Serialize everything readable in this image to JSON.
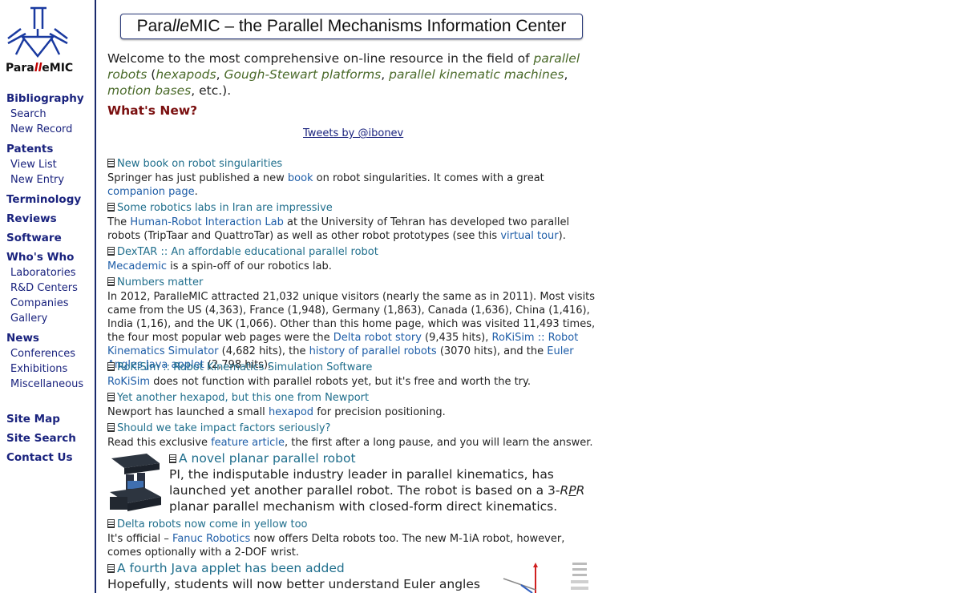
{
  "logo": {
    "part1": "Para",
    "part2": "ll",
    "part3": "eMIC"
  },
  "sidebar": {
    "bibliography": "Bibliography",
    "search": "Search",
    "new_record": "New Record",
    "patents": "Patents",
    "view_list": "View List",
    "new_entry": "New Entry",
    "terminology": "Terminology",
    "reviews": "Reviews",
    "software": "Software",
    "whos_who": "Who's Who",
    "laboratories": "Laboratories",
    "rd_centers": "R&D Centers",
    "companies": "Companies",
    "gallery": "Gallery",
    "news": "News",
    "conferences": "Conferences",
    "exhibitions": "Exhibitions",
    "miscellaneous": "Miscellaneous",
    "site_map": "Site Map",
    "site_search": "Site Search",
    "contact_us": "Contact Us"
  },
  "banner": {
    "pre": "Para",
    "it": "lle",
    "post": "MIC – the Parallel Mechanisms Information Center"
  },
  "welcome": {
    "t1": "Welcome to the most comprehensive on-line resource in the field of ",
    "l1": "parallel robots",
    "t2": " (",
    "l2": "hexapods",
    "t3": ", ",
    "l3": "Gough-Stewart platforms",
    "t4": ", ",
    "l4": "parallel kinematic machines",
    "t5": ", ",
    "l5": "motion bases",
    "t6": ", etc.)."
  },
  "whats_new": "What's New?",
  "tweets": "Tweets by @ibonev",
  "items": {
    "i1": {
      "title": "New book on robot singularities",
      "b1": "Springer has just published a new ",
      "l1": "book",
      "b2": " on robot singularities. It comes with a great ",
      "l2": "companion page",
      "b3": "."
    },
    "i2": {
      "title": "Some robotics labs in Iran are impressive",
      "b1": "The ",
      "l1": "Human-Robot Interaction Lab",
      "b2": " at the University of Tehran has developed two parallel robots (TripTaar and QuattroTar) as well as other robot prototypes (see this ",
      "l2": "virtual tour",
      "b3": ")."
    },
    "i3": {
      "title": "DexTAR :: An affordable educational parallel robot",
      "l1": "Mecademic",
      "b1": " is a spin-off of our robotics lab."
    },
    "i4": {
      "title": "Numbers matter",
      "b1": "In 2012, ParalleMIC attracted 21,032 unique visitors (nearly the same as in 2011). Most visits came from the US (4,363), France (1,948), Germany (1,863), Canada (1,636), China (1,416), India (1,16), and the UK (1,066). Other than this home page, which was visited 11,493 times, the four most popular web pages were the ",
      "l1": "Delta robot story",
      "b2": " (9,435 hits), ",
      "l2": "RoKiSim :: Robot Kinematics Simulator",
      "b3": " (4,682 hits), the ",
      "l3": "history of parallel robots",
      "b4": " (3070 hits), and the ",
      "l4": "Euler Angles Java applet",
      "b5": " (2,798 hits)."
    },
    "i5": {
      "title": "RoKiSim :: Robot Kinematics Simulation Software",
      "l1": "RoKiSim",
      "b1": " does not function with parallel robots yet, but it's free and worth the try."
    },
    "i6": {
      "title": "Yet another hexapod, but this one from Newport",
      "b1": "Newport has launched a small ",
      "l1": "hexapod",
      "b2": " for precision positioning."
    },
    "i7": {
      "title": "Should we take impact factors seriously?",
      "b1": "Read this exclusive ",
      "l1": "feature article",
      "b2": ", the first after a long pause, and you will learn the answer."
    },
    "i8": {
      "title": "A novel planar parallel robot",
      "b1": "PI, the indisputable industry leader in parallel kinematics, has launched yet another parallel robot. The robot is based on a 3-",
      "r": "R",
      "p": "P",
      "r2": "R",
      "b2": " planar parallel mechanism with closed-form direct kinematics."
    },
    "i9": {
      "title": "Delta robots now come in yellow too",
      "b1": "It's official – ",
      "l1": "Fanuc Robotics",
      "b2": " now offers Delta robots too. The new M-1iA robot, however, comes optionally with a 2-DOF wrist."
    },
    "i10": {
      "title": "A fourth Java applet has been added",
      "b1": "Hopefully, students will now better understand Euler angles and"
    }
  },
  "colors": {
    "nav": "#1a237e",
    "title_link": "#1f6e8c",
    "body_link": "#1f5ea8",
    "whats_new": "#7a0f0f",
    "welcome_link": "#4a6a2a"
  }
}
